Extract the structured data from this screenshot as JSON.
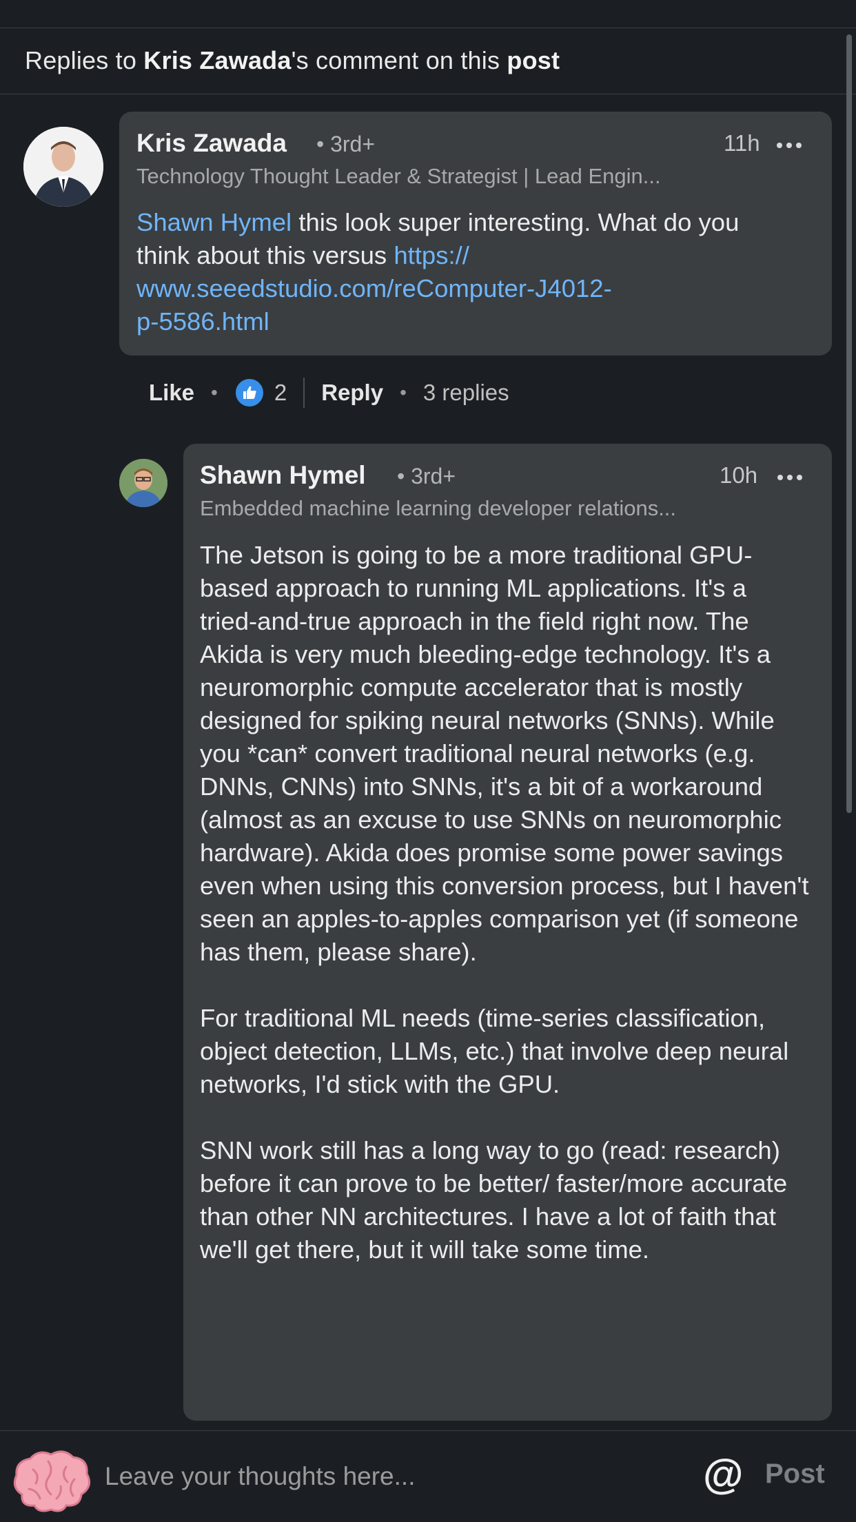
{
  "header": {
    "prefix": "Replies to ",
    "author": "Kris Zawada",
    "middle": "'s comment on this ",
    "object": "post"
  },
  "comment": {
    "author": "Kris Zawada",
    "degree": "• 3rd+",
    "time": "11h",
    "headline": "Technology Thought Leader & Strategist | Lead Engin...",
    "mention": "Shawn Hymel",
    "text_after_mention": " this look super interesting.  What do you think about this versus ",
    "link_line1": "https://",
    "link_line2": "www.seeedstudio.com/reComputer-J4012-",
    "link_line3": "p-5586.html"
  },
  "actions": {
    "like_label": "Like",
    "like_count": "2",
    "reply_label": "Reply",
    "replies_label": "3 replies"
  },
  "reply": {
    "author": "Shawn Hymel",
    "degree": "• 3rd+",
    "time": "10h",
    "headline": "Embedded machine learning developer relations...",
    "paragraph1": "The Jetson is going to be a more traditional GPU-based approach to running ML applications. It's a tried-and-true approach in the field right now. The Akida is very much bleeding-edge technology. It's a neuromorphic compute accelerator that is mostly designed for spiking neural networks (SNNs). While you *can* convert traditional neural networks (e.g. DNNs, CNNs) into SNNs, it's a bit of a workaround (almost as an excuse to use SNNs on neuromorphic hardware). Akida does promise some power savings even when using this conversion process, but I haven't seen an apples-to-apples comparison yet (if someone has them, please share).",
    "paragraph2": "For traditional ML needs (time-series classification, object detection, LLMs, etc.) that involve deep neural networks, I'd stick with the GPU.",
    "paragraph3": "SNN work still has a long way to go (read: research) before it can prove to be better/ faster/more accurate than other NN architectures. I have a lot of faith that we'll get there, but it will take some time."
  },
  "composer": {
    "placeholder": "Leave your thoughts here...",
    "at_label": "@",
    "post_label": "Post"
  },
  "colors": {
    "background": "#1b1f23",
    "bubble": "#3a3e41",
    "link": "#70b5f9",
    "like_icon": "#378fe9"
  }
}
